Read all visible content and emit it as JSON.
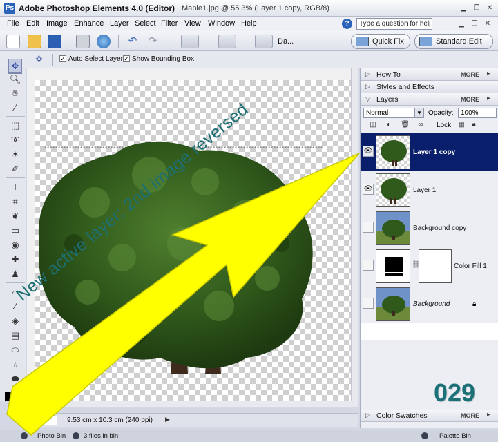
{
  "window": {
    "app_title": "Adobe Photoshop Elements 4.0 (Editor)",
    "doc_title": "Maple1.jpg @ 55.3% (Layer 1 copy, RGB/8)"
  },
  "menu": [
    "File",
    "Edit",
    "Image",
    "Enhance",
    "Layer",
    "Select",
    "Filter",
    "View",
    "Window",
    "Help"
  ],
  "help": {
    "placeholder": "Type a question for help"
  },
  "shortcuts": {
    "da_label": "Da...",
    "quick_fix": "Quick Fix",
    "standard_edit": "Standard Edit"
  },
  "options": {
    "auto_select": "Auto Select Layer",
    "show_bounding": "Show Bounding Box"
  },
  "status": {
    "dimensions": "9.53 cm x 10.3 cm (240 ppi)"
  },
  "bin": {
    "photo_bin": "Photo Bin",
    "files": "3 files in bin",
    "palette_bin": "Palette Bin"
  },
  "palettes": {
    "how_to": "How To",
    "styles": "Styles and Effects",
    "layers": "Layers",
    "color_swatches": "Color Swatches",
    "more": "MORE"
  },
  "layers_panel": {
    "blend_mode": "Normal",
    "opacity_label": "Opacity:",
    "opacity_value": "100%",
    "lock_label": "Lock:",
    "layers": [
      {
        "name": "Layer 1 copy",
        "visible": true,
        "selected": true
      },
      {
        "name": "Layer 1",
        "visible": true,
        "selected": false
      },
      {
        "name": "Background copy",
        "visible": false,
        "selected": false
      },
      {
        "name": "Color Fill 1",
        "visible": false,
        "selected": false
      },
      {
        "name": "Background",
        "visible": false,
        "selected": false
      }
    ]
  },
  "annotation": {
    "arrow_text": "New active layer: 2nd image reversed",
    "counter": "029",
    "arrow_color": "#ffff00",
    "text_color": "#1e6f74"
  }
}
